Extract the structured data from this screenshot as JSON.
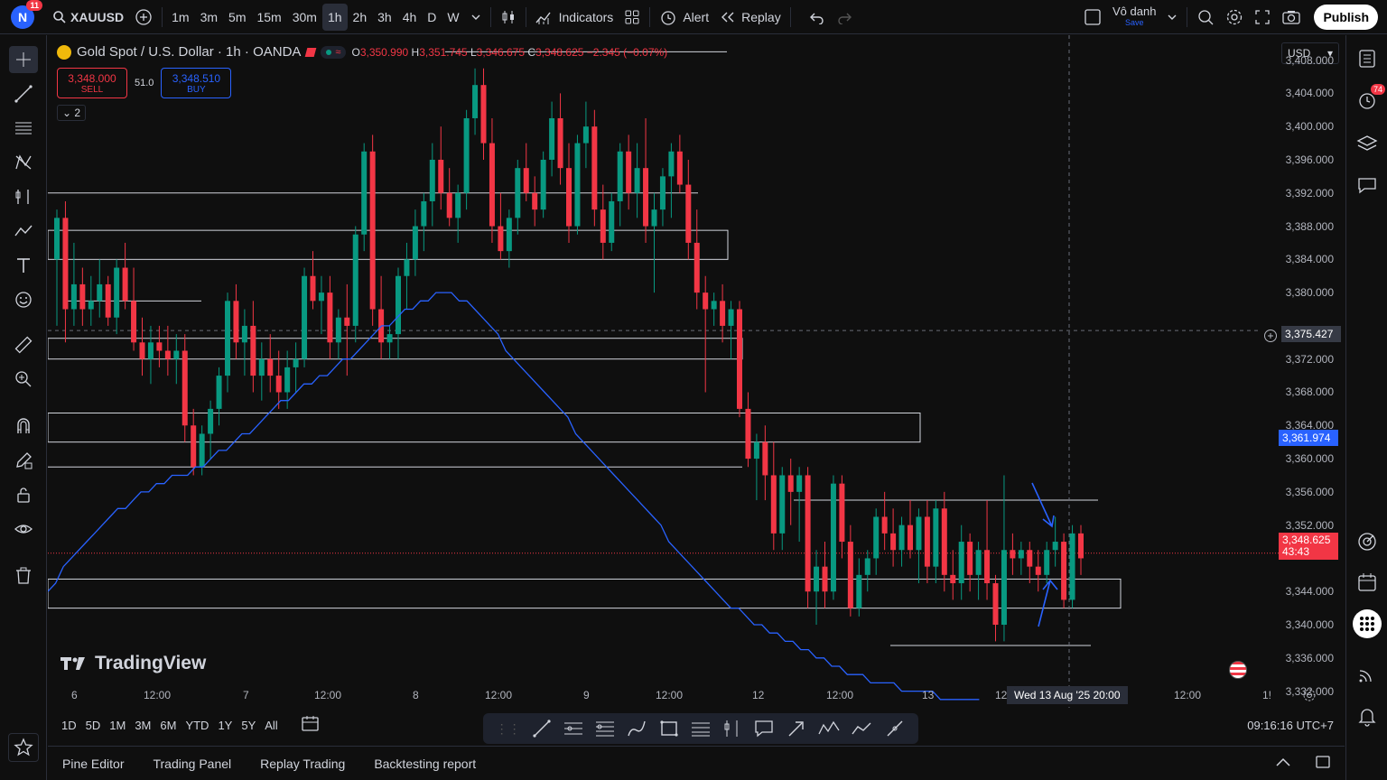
{
  "topbar": {
    "avatar_letter": "N",
    "avatar_badge": "11",
    "symbol": "XAUUSD",
    "intervals": [
      "1m",
      "3m",
      "5m",
      "15m",
      "30m",
      "1h",
      "2h",
      "3h",
      "4h",
      "D",
      "W"
    ],
    "active_interval": "1h",
    "indicators_label": "Indicators",
    "alert_label": "Alert",
    "replay_label": "Replay",
    "layout_name": "Vô danh",
    "layout_sub": "Save",
    "publish_label": "Publish"
  },
  "legend": {
    "title": "Gold Spot / U.S. Dollar · 1h · OANDA",
    "o_label": "O",
    "o": "3,350.990",
    "h_label": "H",
    "h": "3,351.745",
    "l_label": "L",
    "l": "3,346.675",
    "c_label": "C",
    "c": "3,348.625",
    "change": "−2.345 (−0.07%)"
  },
  "trade": {
    "sell_price": "3,348.000",
    "sell_label": "SELL",
    "spread": "51.0",
    "buy_price": "3,348.510",
    "buy_label": "BUY",
    "collapse_label": "2"
  },
  "watermark": "TradingView",
  "currency": "USD",
  "price_axis": [
    "3,408.000",
    "3,404.000",
    "3,400.000",
    "3,396.000",
    "3,392.000",
    "3,388.000",
    "3,384.000",
    "3,380.000",
    "3,372.000",
    "3,368.000",
    "3,364.000",
    "3,360.000",
    "3,356.000",
    "3,352.000",
    "3,344.000",
    "3,340.000",
    "3,336.000",
    "3,332.000"
  ],
  "crosshair_price": "3,375.427",
  "ma_price": "3,361.974",
  "last_price": "3,348.625",
  "countdown": "43:43",
  "time_axis": [
    "6",
    "12:00",
    "7",
    "12:00",
    "8",
    "12:00",
    "9",
    "12:00",
    "12",
    "12:00",
    "13",
    "12",
    "12:00",
    "1!"
  ],
  "crosshair_time": "Wed 13 Aug '25   20:00",
  "ranges": [
    "1D",
    "5D",
    "1M",
    "3M",
    "6M",
    "YTD",
    "1Y",
    "5Y",
    "All"
  ],
  "clock": "09:16:16 UTC+7",
  "panel_tabs": [
    "Pine Editor",
    "Trading Panel",
    "Replay Trading",
    "Backtesting report"
  ],
  "right_badge": "74",
  "colors": {
    "up": "#089981",
    "down": "#f23645",
    "ma": "#2962ff",
    "accent": "#2962ff"
  },
  "chart_data": {
    "type": "candlestick",
    "title": "Gold Spot / U.S. Dollar · 1h · OANDA",
    "ylim": [
      3330,
      3411
    ],
    "candles": [
      [
        3384,
        3390,
        3376,
        3389
      ],
      [
        3389,
        3391,
        3374,
        3378
      ],
      [
        3378,
        3386,
        3376,
        3381
      ],
      [
        3381,
        3383,
        3376,
        3378
      ],
      [
        3378,
        3382,
        3376,
        3379
      ],
      [
        3379,
        3384,
        3377,
        3381
      ],
      [
        3381,
        3382,
        3376,
        3377
      ],
      [
        3377,
        3384,
        3375,
        3383
      ],
      [
        3383,
        3386,
        3378,
        3379
      ],
      [
        3379,
        3383,
        3373,
        3374
      ],
      [
        3374,
        3377,
        3370,
        3372
      ],
      [
        3372,
        3376,
        3369,
        3374
      ],
      [
        3374,
        3376,
        3371,
        3373
      ],
      [
        3373,
        3376,
        3370,
        3372
      ],
      [
        3372,
        3375,
        3369,
        3373
      ],
      [
        3373,
        3375,
        3362,
        3364
      ],
      [
        3364,
        3366,
        3358,
        3359
      ],
      [
        3359,
        3364,
        3358,
        3363
      ],
      [
        3363,
        3367,
        3360,
        3366
      ],
      [
        3366,
        3371,
        3364,
        3370
      ],
      [
        3370,
        3380,
        3368,
        3379
      ],
      [
        3379,
        3381,
        3372,
        3374
      ],
      [
        3374,
        3378,
        3370,
        3376
      ],
      [
        3376,
        3379,
        3368,
        3370
      ],
      [
        3370,
        3374,
        3367,
        3372
      ],
      [
        3372,
        3375,
        3368,
        3370
      ],
      [
        3370,
        3373,
        3366,
        3368
      ],
      [
        3368,
        3373,
        3366,
        3371
      ],
      [
        3371,
        3374,
        3368,
        3372
      ],
      [
        3372,
        3383,
        3371,
        3382
      ],
      [
        3382,
        3385,
        3378,
        3379
      ],
      [
        3379,
        3382,
        3375,
        3380
      ],
      [
        3380,
        3382,
        3372,
        3374
      ],
      [
        3374,
        3378,
        3372,
        3377
      ],
      [
        3377,
        3381,
        3370,
        3376
      ],
      [
        3376,
        3388,
        3374,
        3387
      ],
      [
        3387,
        3398,
        3385,
        3397
      ],
      [
        3397,
        3399,
        3376,
        3378
      ],
      [
        3378,
        3382,
        3372,
        3374
      ],
      [
        3374,
        3376,
        3372,
        3375
      ],
      [
        3375,
        3383,
        3372,
        3382
      ],
      [
        3382,
        3386,
        3378,
        3384
      ],
      [
        3384,
        3390,
        3382,
        3388
      ],
      [
        3388,
        3392,
        3385,
        3391
      ],
      [
        3391,
        3398,
        3388,
        3396
      ],
      [
        3396,
        3400,
        3390,
        3392
      ],
      [
        3392,
        3395,
        3388,
        3389
      ],
      [
        3389,
        3393,
        3386,
        3392
      ],
      [
        3392,
        3402,
        3390,
        3401
      ],
      [
        3401,
        3407,
        3399,
        3405
      ],
      [
        3405,
        3407,
        3396,
        3398
      ],
      [
        3398,
        3401,
        3386,
        3388
      ],
      [
        3388,
        3392,
        3384,
        3385
      ],
      [
        3385,
        3390,
        3383,
        3389
      ],
      [
        3389,
        3396,
        3387,
        3395
      ],
      [
        3395,
        3398,
        3391,
        3392
      ],
      [
        3392,
        3394,
        3388,
        3390
      ],
      [
        3390,
        3397,
        3389,
        3396
      ],
      [
        3396,
        3403,
        3394,
        3401
      ],
      [
        3401,
        3404,
        3393,
        3395
      ],
      [
        3395,
        3398,
        3386,
        3388
      ],
      [
        3388,
        3399,
        3387,
        3398
      ],
      [
        3398,
        3403,
        3395,
        3400
      ],
      [
        3400,
        3402,
        3388,
        3390
      ],
      [
        3390,
        3393,
        3384,
        3386
      ],
      [
        3386,
        3392,
        3385,
        3391
      ],
      [
        3391,
        3398,
        3388,
        3397
      ],
      [
        3397,
        3399,
        3390,
        3392
      ],
      [
        3392,
        3398,
        3389,
        3395
      ],
      [
        3395,
        3401,
        3386,
        3388
      ],
      [
        3388,
        3392,
        3380,
        3390
      ],
      [
        3390,
        3395,
        3388,
        3394
      ],
      [
        3394,
        3398,
        3389,
        3397
      ],
      [
        3397,
        3399,
        3392,
        3393
      ],
      [
        3393,
        3396,
        3384,
        3386
      ],
      [
        3386,
        3390,
        3378,
        3380
      ],
      [
        3380,
        3382,
        3368,
        3378
      ],
      [
        3378,
        3380,
        3376,
        3379
      ],
      [
        3379,
        3381,
        3374,
        3376
      ],
      [
        3376,
        3379,
        3372,
        3378
      ],
      [
        3378,
        3379,
        3365,
        3366
      ],
      [
        3366,
        3368,
        3359,
        3360
      ],
      [
        3360,
        3363,
        3355,
        3362
      ],
      [
        3362,
        3364,
        3355,
        3358
      ],
      [
        3358,
        3362,
        3349,
        3351
      ],
      [
        3351,
        3359,
        3349,
        3358
      ],
      [
        3358,
        3360,
        3352,
        3356
      ],
      [
        3356,
        3359,
        3350,
        3358
      ],
      [
        3358,
        3359,
        3342,
        3344
      ],
      [
        3344,
        3349,
        3340,
        3347
      ],
      [
        3347,
        3350,
        3342,
        3344
      ],
      [
        3344,
        3358,
        3343,
        3357
      ],
      [
        3357,
        3358,
        3348,
        3350
      ],
      [
        3350,
        3352,
        3341,
        3342
      ],
      [
        3342,
        3348,
        3341,
        3346
      ],
      [
        3346,
        3349,
        3344,
        3348
      ],
      [
        3348,
        3354,
        3346,
        3353
      ],
      [
        3353,
        3356,
        3349,
        3351
      ],
      [
        3351,
        3354,
        3347,
        3349
      ],
      [
        3349,
        3353,
        3347,
        3352
      ],
      [
        3352,
        3355,
        3348,
        3349
      ],
      [
        3349,
        3354,
        3345,
        3353
      ],
      [
        3353,
        3355,
        3345,
        3347
      ],
      [
        3347,
        3355,
        3345,
        3354
      ],
      [
        3354,
        3356,
        3344,
        3346
      ],
      [
        3346,
        3349,
        3343,
        3345
      ],
      [
        3345,
        3352,
        3343,
        3350
      ],
      [
        3350,
        3351,
        3344,
        3346
      ],
      [
        3346,
        3350,
        3343,
        3349
      ],
      [
        3349,
        3355,
        3343,
        3345
      ],
      [
        3345,
        3346,
        3338,
        3340
      ],
      [
        3340,
        3358,
        3338,
        3349
      ],
      [
        3349,
        3351,
        3346,
        3348
      ],
      [
        3348,
        3350,
        3346,
        3349
      ],
      [
        3349,
        3350,
        3345,
        3347
      ],
      [
        3347,
        3349,
        3344,
        3346
      ],
      [
        3346,
        3350,
        3345,
        3349
      ],
      [
        3349,
        3353,
        3347,
        3350
      ],
      [
        3350,
        3351,
        3342,
        3343
      ],
      [
        3343,
        3352,
        3342,
        3351
      ],
      [
        3351,
        3352,
        3346,
        3348
      ]
    ],
    "ma_values": [
      3344,
      3345,
      3347,
      3348,
      3349,
      3350,
      3351,
      3352,
      3353,
      3354,
      3354,
      3355,
      3356,
      3356,
      3357,
      3357,
      3358,
      3358,
      3358,
      3359,
      3359,
      3360,
      3361,
      3361,
      3362,
      3363,
      3363,
      3364,
      3365,
      3366,
      3367,
      3367,
      3368,
      3369,
      3369,
      3370,
      3370,
      3371,
      3372,
      3372,
      3373,
      3374,
      3375,
      3376,
      3376,
      3377,
      3378,
      3378,
      3379,
      3379,
      3380,
      3380,
      3380,
      3379,
      3379,
      3378,
      3377,
      3376,
      3375,
      3373,
      3372,
      3371,
      3370,
      3369,
      3368,
      3367,
      3366,
      3365,
      3363,
      3362,
      3361,
      3360,
      3359,
      3358,
      3357,
      3356,
      3355,
      3354,
      3353,
      3352,
      3350,
      3349,
      3348,
      3347,
      3346,
      3345,
      3344,
      3343,
      3342,
      3342,
      3341,
      3340,
      3340,
      3339,
      3339,
      3338,
      3338,
      3337,
      3337,
      3336,
      3336,
      3335,
      3335,
      3334,
      3334,
      3334,
      3333,
      3333,
      3333,
      3333,
      3332,
      3332,
      3332,
      3332,
      3332,
      3331,
      3331,
      3331,
      3331,
      3331,
      3331
    ],
    "zones": [
      {
        "top": 3392,
        "bottom": 3392
      },
      {
        "top": 3387.5,
        "bottom": 3384
      },
      {
        "top": 3374.5,
        "bottom": 3372
      },
      {
        "top": 3365.5,
        "bottom": 3362
      },
      {
        "top": 3359,
        "bottom": 3359
      },
      {
        "top": 3345.5,
        "bottom": 3342
      }
    ]
  }
}
